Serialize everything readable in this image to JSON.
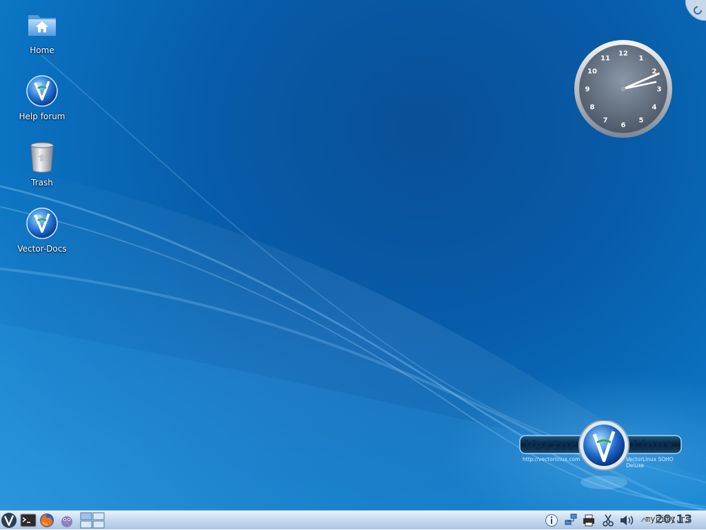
{
  "desktop": {
    "icons": [
      {
        "label": "Home",
        "icon": "home-folder-icon"
      },
      {
        "label": "Help forum",
        "icon": "vector-globe-icon"
      },
      {
        "label": "Trash",
        "icon": "trash-icon"
      },
      {
        "label": "Vector-Docs",
        "icon": "vector-globe-icon"
      }
    ]
  },
  "clock_widget": {
    "numerals": [
      "12",
      "1",
      "2",
      "3",
      "4",
      "5",
      "6",
      "7",
      "8",
      "9",
      "10",
      "11"
    ],
    "hour": 2,
    "minute": 13
  },
  "branding": {
    "left": "Vector",
    "right": "Linux",
    "trademark": "™",
    "url": "http://vectorlinux.com",
    "edition": "VectorLinux SOHO Deluxe"
  },
  "taskbar": {
    "launchers": [
      {
        "name": "vector-menu-icon"
      },
      {
        "name": "terminal-icon"
      },
      {
        "name": "firefox-icon"
      },
      {
        "name": "pidgin-icon"
      },
      {
        "name": "pager-icon"
      }
    ],
    "tray": [
      {
        "name": "info-icon"
      },
      {
        "name": "network-icon"
      },
      {
        "name": "printer-icon"
      },
      {
        "name": "clipboard-scissors-icon"
      },
      {
        "name": "volume-icon"
      }
    ],
    "clock": "20:13"
  },
  "watermark": "mycity.rs",
  "colors": {
    "accent": "#0a5aa8",
    "taskbar": "#c9dcf0"
  }
}
